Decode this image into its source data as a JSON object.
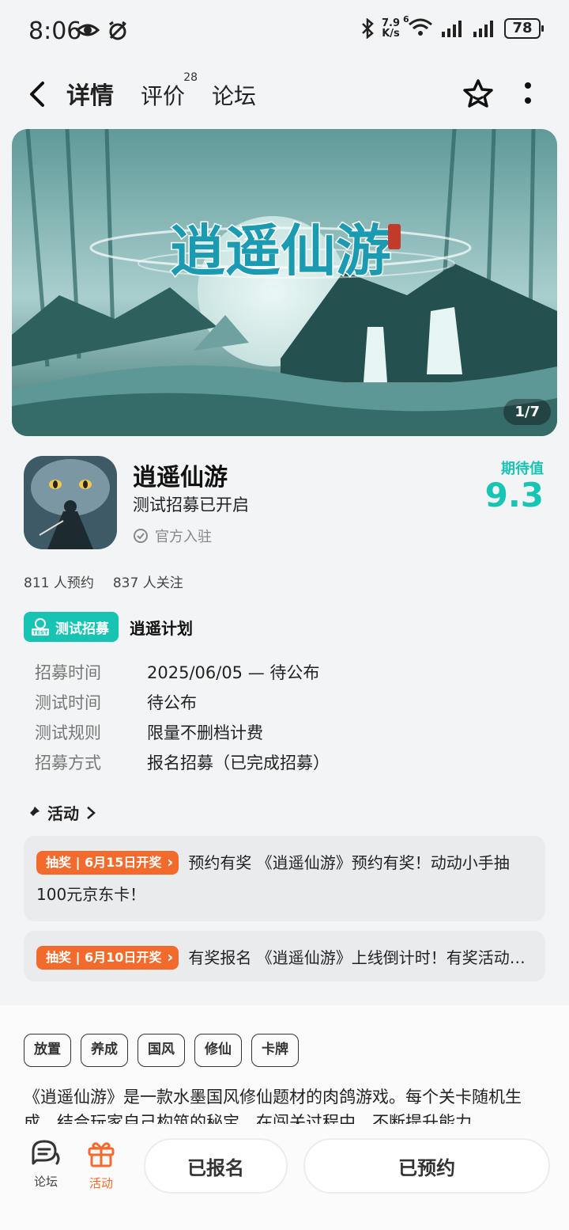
{
  "status_bar": {
    "time": "8:06",
    "net_speed_value": "7.9",
    "net_speed_unit": "K/s",
    "wifi_label": "6",
    "battery": "78"
  },
  "nav": {
    "tabs": [
      {
        "label": "详情",
        "active": true
      },
      {
        "label": "评价",
        "badge": "28"
      },
      {
        "label": "论坛"
      }
    ]
  },
  "banner": {
    "pager": "1/7",
    "logo_text": "逍遥仙游"
  },
  "game": {
    "title": "逍遥仙游",
    "subtitle": "测试招募已开启",
    "official": "官方入驻",
    "score_label": "期待值",
    "score": "9.3",
    "reservations": "811 人预约",
    "followers": "837 人关注"
  },
  "recruit": {
    "badge": "测试招募",
    "badge_icon_text": "TEST",
    "plan_name": "逍遥计划",
    "rows": [
      {
        "key": "招募时间",
        "value": "2025/06/05 — 待公布"
      },
      {
        "key": "测试时间",
        "value": "待公布"
      },
      {
        "key": "测试规则",
        "value": "限量不删档计费"
      },
      {
        "key": "招募方式",
        "value": "报名招募（已完成招募）"
      }
    ]
  },
  "activity": {
    "heading": "活动",
    "items": [
      {
        "tag": "抽奖 | 6月15日开奖",
        "text": "预约有奖 《逍遥仙游》预约有奖！动动小手抽100元京东卡！"
      },
      {
        "tag": "抽奖 | 6月10日开奖",
        "text": "有奖报名 《逍遥仙游》上线倒计时！有奖活动开启中"
      }
    ]
  },
  "tags": [
    "放置",
    "养成",
    "国风",
    "修仙",
    "卡牌"
  ],
  "description": "《逍遥仙游》是一款水墨国风修仙题材的肉鸽游戏。每个关卡随机生成，结合玩家自己构筑的秘宝，在闯关过程中，不断提升能力",
  "bottom_bar": {
    "forum": "论坛",
    "activity": "活动",
    "signed_button": "已报名",
    "reserved_button": "已预约"
  },
  "colors": {
    "accent": "#18c4b4",
    "lottery": "#f26a2c",
    "banner_base": "#3f7f7c"
  }
}
